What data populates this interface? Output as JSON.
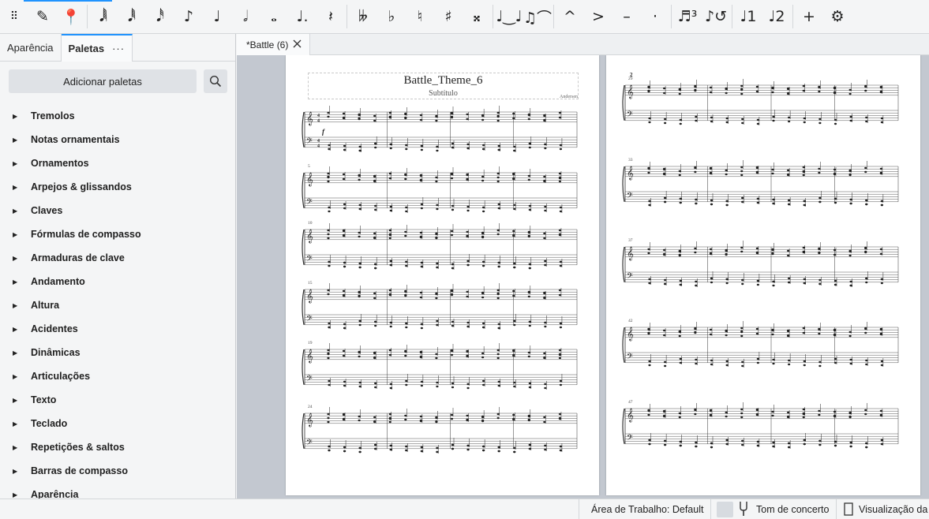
{
  "toolbar": {
    "items": [
      {
        "name": "grip-handle-icon",
        "glyph": "⠿"
      },
      {
        "name": "note-input-pencil-icon",
        "glyph": "✎"
      },
      {
        "name": "rest-input-pin-icon",
        "glyph": "📍"
      },
      {
        "name": "duration-64th-icon",
        "glyph": "𝅘𝅥𝅲"
      },
      {
        "name": "duration-32nd-icon",
        "glyph": "𝅘𝅥𝅱"
      },
      {
        "name": "duration-16th-icon",
        "glyph": "𝅘𝅥𝅰"
      },
      {
        "name": "duration-eighth-icon",
        "glyph": "♪"
      },
      {
        "name": "duration-quarter-icon",
        "glyph": "♩"
      },
      {
        "name": "duration-half-icon",
        "glyph": "𝅗𝅥"
      },
      {
        "name": "duration-whole-icon",
        "glyph": "𝅝"
      },
      {
        "name": "augmentation-dot-icon",
        "glyph": "♩."
      },
      {
        "name": "rest-icon",
        "glyph": "𝄽"
      },
      {
        "name": "double-flat-icon",
        "glyph": "𝄫"
      },
      {
        "name": "flat-icon",
        "glyph": "♭"
      },
      {
        "name": "natural-icon",
        "glyph": "♮"
      },
      {
        "name": "sharp-icon",
        "glyph": "♯"
      },
      {
        "name": "double-sharp-icon",
        "glyph": "𝄪"
      },
      {
        "name": "tie-icon",
        "glyph": "♩‿♩"
      },
      {
        "name": "slur-icon",
        "glyph": "♫⌒"
      },
      {
        "name": "marcato-icon",
        "glyph": "^"
      },
      {
        "name": "accent-icon",
        "glyph": ">"
      },
      {
        "name": "tenuto-icon",
        "glyph": "–"
      },
      {
        "name": "staccato-icon",
        "glyph": "·"
      },
      {
        "name": "tuplet-icon",
        "glyph": "♬³"
      },
      {
        "name": "flip-direction-icon",
        "glyph": "♪↺"
      },
      {
        "name": "voice-1-icon",
        "glyph": "♩1"
      },
      {
        "name": "voice-2-icon",
        "glyph": "♩2"
      },
      {
        "name": "add-icon",
        "glyph": "+"
      },
      {
        "name": "settings-gear-icon",
        "glyph": "⚙"
      }
    ]
  },
  "left_panel": {
    "tabs": [
      {
        "label": "Aparência",
        "active": false
      },
      {
        "label": "Paletas",
        "active": true,
        "menu": "···"
      }
    ],
    "add_palettes_label": "Adicionar paletas",
    "palettes": [
      "Tremolos",
      "Notas ornamentais",
      "Ornamentos",
      "Arpejos & glissandos",
      "Claves",
      "Fórmulas de compasso",
      "Armaduras de clave",
      "Andamento",
      "Altura",
      "Acidentes",
      "Dinâmicas",
      "Articulações",
      "Texto",
      "Teclado",
      "Repetições & saltos",
      "Barras de compasso",
      "Aparência"
    ]
  },
  "document": {
    "tab_label": "*Battle (6)",
    "page1": {
      "title": "Battle_Theme_6",
      "subtitle": "Subtítulo",
      "composer": "Andersen",
      "systems": [
        {
          "measure_number": "",
          "dynamic": "f"
        },
        {
          "measure_number": "5"
        },
        {
          "measure_number": "10"
        },
        {
          "measure_number": "15"
        },
        {
          "measure_number": "19"
        },
        {
          "measure_number": "24"
        }
      ]
    },
    "page2": {
      "page_number": "2",
      "systems": [
        {
          "measure_number": "29"
        },
        {
          "measure_number": "33"
        },
        {
          "measure_number": "37"
        },
        {
          "measure_number": "42"
        },
        {
          "measure_number": "47"
        }
      ]
    }
  },
  "status_bar": {
    "workspace": "Área de Trabalho: Default",
    "concert_pitch": "Tom de concerto",
    "view_mode": "Visualização da p"
  }
}
